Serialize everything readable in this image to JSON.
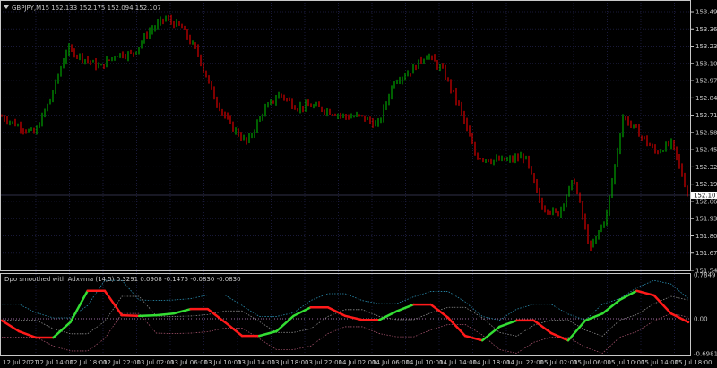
{
  "header": {
    "symbol": "GBPJPY,M15",
    "ohlc": "152.133 152.175 152.094 152.107"
  },
  "indicator_header": {
    "name": "Dpo smoothed with Adxvma",
    "params": "(14,5)",
    "values": "0.3291 0.0908 -0.1475 -0.0830 -0.0830"
  },
  "colors": {
    "bull": "#00c000",
    "bear": "#ff0000",
    "up_line": "#33dd33",
    "down_line": "#ff1a1a",
    "band_upper": "#2a8db0",
    "band_mid": "#8a8a8a",
    "band_lower": "#a0506a",
    "grid": "#1a1a3a",
    "axis": "#c8c8c8"
  },
  "chart_data": [
    {
      "type": "candlestick",
      "title": "GBPJPY,M15",
      "y_ticks": [
        "153.490",
        "153.360",
        "153.230",
        "153.100",
        "152.970",
        "152.840",
        "152.710",
        "152.580",
        "152.450",
        "152.320",
        "152.190",
        "152.060",
        "151.930",
        "151.800",
        "151.670",
        "151.540"
      ],
      "ylim": [
        151.54,
        153.49
      ],
      "current_price": "152.107",
      "close_path": [
        152.7,
        152.63,
        152.57,
        152.84,
        153.21,
        153.14,
        153.07,
        153.17,
        153.17,
        153.34,
        153.44,
        153.37,
        153.17,
        152.84,
        152.63,
        152.5,
        152.74,
        152.87,
        152.77,
        152.78,
        152.74,
        152.7,
        152.7,
        152.63,
        152.97,
        153.04,
        153.17,
        153.04,
        152.77,
        152.4,
        152.37,
        152.37,
        152.4,
        152.03,
        151.96,
        152.23,
        151.69,
        151.96,
        152.7,
        152.57,
        152.43,
        152.5,
        152.107
      ],
      "x_ticks": [
        "12 Jul 2021",
        "12 Jul 14:00",
        "12 Jul 18:00",
        "12 Jul 22:00",
        "13 Jul 02:00",
        "13 Jul 06:00",
        "13 Jul 10:00",
        "13 Jul 14:00",
        "13 Jul 18:00",
        "13 Jul 22:00",
        "14 Jul 02:00",
        "14 Jul 06:00",
        "14 Jul 10:00",
        "14 Jul 14:00",
        "14 Jul 18:00",
        "14 Jul 22:00",
        "15 Jul 02:00",
        "15 Jul 06:00",
        "15 Jul 10:00",
        "15 Jul 14:00",
        "15 Jul 18:00"
      ]
    },
    {
      "type": "line",
      "title": "Dpo smoothed with Adxvma",
      "y_ticks": [
        "0.7849",
        "0.00",
        "-0.6981"
      ],
      "ylim": [
        -0.6981,
        0.7849
      ],
      "main_line": [
        -0.03,
        -0.22,
        -0.33,
        -0.33,
        -0.06,
        0.49,
        0.49,
        0.06,
        0.05,
        0.06,
        0.09,
        0.17,
        0.17,
        -0.06,
        -0.3,
        -0.3,
        -0.22,
        0.05,
        0.2,
        0.2,
        0.05,
        -0.02,
        -0.02,
        0.13,
        0.25,
        0.25,
        0.02,
        -0.3,
        -0.38,
        -0.14,
        -0.03,
        -0.03,
        -0.25,
        -0.38,
        -0.03,
        0.09,
        0.33,
        0.49,
        0.41,
        0.09,
        -0.06
      ]
    }
  ]
}
